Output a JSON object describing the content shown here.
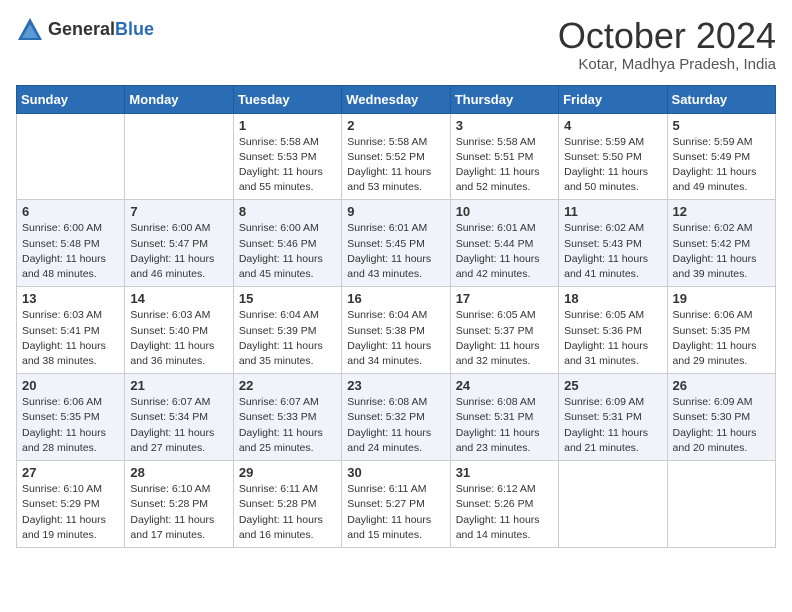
{
  "logo": {
    "general": "General",
    "blue": "Blue"
  },
  "title": "October 2024",
  "location": "Kotar, Madhya Pradesh, India",
  "days_of_week": [
    "Sunday",
    "Monday",
    "Tuesday",
    "Wednesday",
    "Thursday",
    "Friday",
    "Saturday"
  ],
  "weeks": [
    [
      {
        "day": "",
        "sunrise": "",
        "sunset": "",
        "daylight": ""
      },
      {
        "day": "",
        "sunrise": "",
        "sunset": "",
        "daylight": ""
      },
      {
        "day": "1",
        "sunrise": "Sunrise: 5:58 AM",
        "sunset": "Sunset: 5:53 PM",
        "daylight": "Daylight: 11 hours and 55 minutes."
      },
      {
        "day": "2",
        "sunrise": "Sunrise: 5:58 AM",
        "sunset": "Sunset: 5:52 PM",
        "daylight": "Daylight: 11 hours and 53 minutes."
      },
      {
        "day": "3",
        "sunrise": "Sunrise: 5:58 AM",
        "sunset": "Sunset: 5:51 PM",
        "daylight": "Daylight: 11 hours and 52 minutes."
      },
      {
        "day": "4",
        "sunrise": "Sunrise: 5:59 AM",
        "sunset": "Sunset: 5:50 PM",
        "daylight": "Daylight: 11 hours and 50 minutes."
      },
      {
        "day": "5",
        "sunrise": "Sunrise: 5:59 AM",
        "sunset": "Sunset: 5:49 PM",
        "daylight": "Daylight: 11 hours and 49 minutes."
      }
    ],
    [
      {
        "day": "6",
        "sunrise": "Sunrise: 6:00 AM",
        "sunset": "Sunset: 5:48 PM",
        "daylight": "Daylight: 11 hours and 48 minutes."
      },
      {
        "day": "7",
        "sunrise": "Sunrise: 6:00 AM",
        "sunset": "Sunset: 5:47 PM",
        "daylight": "Daylight: 11 hours and 46 minutes."
      },
      {
        "day": "8",
        "sunrise": "Sunrise: 6:00 AM",
        "sunset": "Sunset: 5:46 PM",
        "daylight": "Daylight: 11 hours and 45 minutes."
      },
      {
        "day": "9",
        "sunrise": "Sunrise: 6:01 AM",
        "sunset": "Sunset: 5:45 PM",
        "daylight": "Daylight: 11 hours and 43 minutes."
      },
      {
        "day": "10",
        "sunrise": "Sunrise: 6:01 AM",
        "sunset": "Sunset: 5:44 PM",
        "daylight": "Daylight: 11 hours and 42 minutes."
      },
      {
        "day": "11",
        "sunrise": "Sunrise: 6:02 AM",
        "sunset": "Sunset: 5:43 PM",
        "daylight": "Daylight: 11 hours and 41 minutes."
      },
      {
        "day": "12",
        "sunrise": "Sunrise: 6:02 AM",
        "sunset": "Sunset: 5:42 PM",
        "daylight": "Daylight: 11 hours and 39 minutes."
      }
    ],
    [
      {
        "day": "13",
        "sunrise": "Sunrise: 6:03 AM",
        "sunset": "Sunset: 5:41 PM",
        "daylight": "Daylight: 11 hours and 38 minutes."
      },
      {
        "day": "14",
        "sunrise": "Sunrise: 6:03 AM",
        "sunset": "Sunset: 5:40 PM",
        "daylight": "Daylight: 11 hours and 36 minutes."
      },
      {
        "day": "15",
        "sunrise": "Sunrise: 6:04 AM",
        "sunset": "Sunset: 5:39 PM",
        "daylight": "Daylight: 11 hours and 35 minutes."
      },
      {
        "day": "16",
        "sunrise": "Sunrise: 6:04 AM",
        "sunset": "Sunset: 5:38 PM",
        "daylight": "Daylight: 11 hours and 34 minutes."
      },
      {
        "day": "17",
        "sunrise": "Sunrise: 6:05 AM",
        "sunset": "Sunset: 5:37 PM",
        "daylight": "Daylight: 11 hours and 32 minutes."
      },
      {
        "day": "18",
        "sunrise": "Sunrise: 6:05 AM",
        "sunset": "Sunset: 5:36 PM",
        "daylight": "Daylight: 11 hours and 31 minutes."
      },
      {
        "day": "19",
        "sunrise": "Sunrise: 6:06 AM",
        "sunset": "Sunset: 5:35 PM",
        "daylight": "Daylight: 11 hours and 29 minutes."
      }
    ],
    [
      {
        "day": "20",
        "sunrise": "Sunrise: 6:06 AM",
        "sunset": "Sunset: 5:35 PM",
        "daylight": "Daylight: 11 hours and 28 minutes."
      },
      {
        "day": "21",
        "sunrise": "Sunrise: 6:07 AM",
        "sunset": "Sunset: 5:34 PM",
        "daylight": "Daylight: 11 hours and 27 minutes."
      },
      {
        "day": "22",
        "sunrise": "Sunrise: 6:07 AM",
        "sunset": "Sunset: 5:33 PM",
        "daylight": "Daylight: 11 hours and 25 minutes."
      },
      {
        "day": "23",
        "sunrise": "Sunrise: 6:08 AM",
        "sunset": "Sunset: 5:32 PM",
        "daylight": "Daylight: 11 hours and 24 minutes."
      },
      {
        "day": "24",
        "sunrise": "Sunrise: 6:08 AM",
        "sunset": "Sunset: 5:31 PM",
        "daylight": "Daylight: 11 hours and 23 minutes."
      },
      {
        "day": "25",
        "sunrise": "Sunrise: 6:09 AM",
        "sunset": "Sunset: 5:31 PM",
        "daylight": "Daylight: 11 hours and 21 minutes."
      },
      {
        "day": "26",
        "sunrise": "Sunrise: 6:09 AM",
        "sunset": "Sunset: 5:30 PM",
        "daylight": "Daylight: 11 hours and 20 minutes."
      }
    ],
    [
      {
        "day": "27",
        "sunrise": "Sunrise: 6:10 AM",
        "sunset": "Sunset: 5:29 PM",
        "daylight": "Daylight: 11 hours and 19 minutes."
      },
      {
        "day": "28",
        "sunrise": "Sunrise: 6:10 AM",
        "sunset": "Sunset: 5:28 PM",
        "daylight": "Daylight: 11 hours and 17 minutes."
      },
      {
        "day": "29",
        "sunrise": "Sunrise: 6:11 AM",
        "sunset": "Sunset: 5:28 PM",
        "daylight": "Daylight: 11 hours and 16 minutes."
      },
      {
        "day": "30",
        "sunrise": "Sunrise: 6:11 AM",
        "sunset": "Sunset: 5:27 PM",
        "daylight": "Daylight: 11 hours and 15 minutes."
      },
      {
        "day": "31",
        "sunrise": "Sunrise: 6:12 AM",
        "sunset": "Sunset: 5:26 PM",
        "daylight": "Daylight: 11 hours and 14 minutes."
      },
      {
        "day": "",
        "sunrise": "",
        "sunset": "",
        "daylight": ""
      },
      {
        "day": "",
        "sunrise": "",
        "sunset": "",
        "daylight": ""
      }
    ]
  ]
}
